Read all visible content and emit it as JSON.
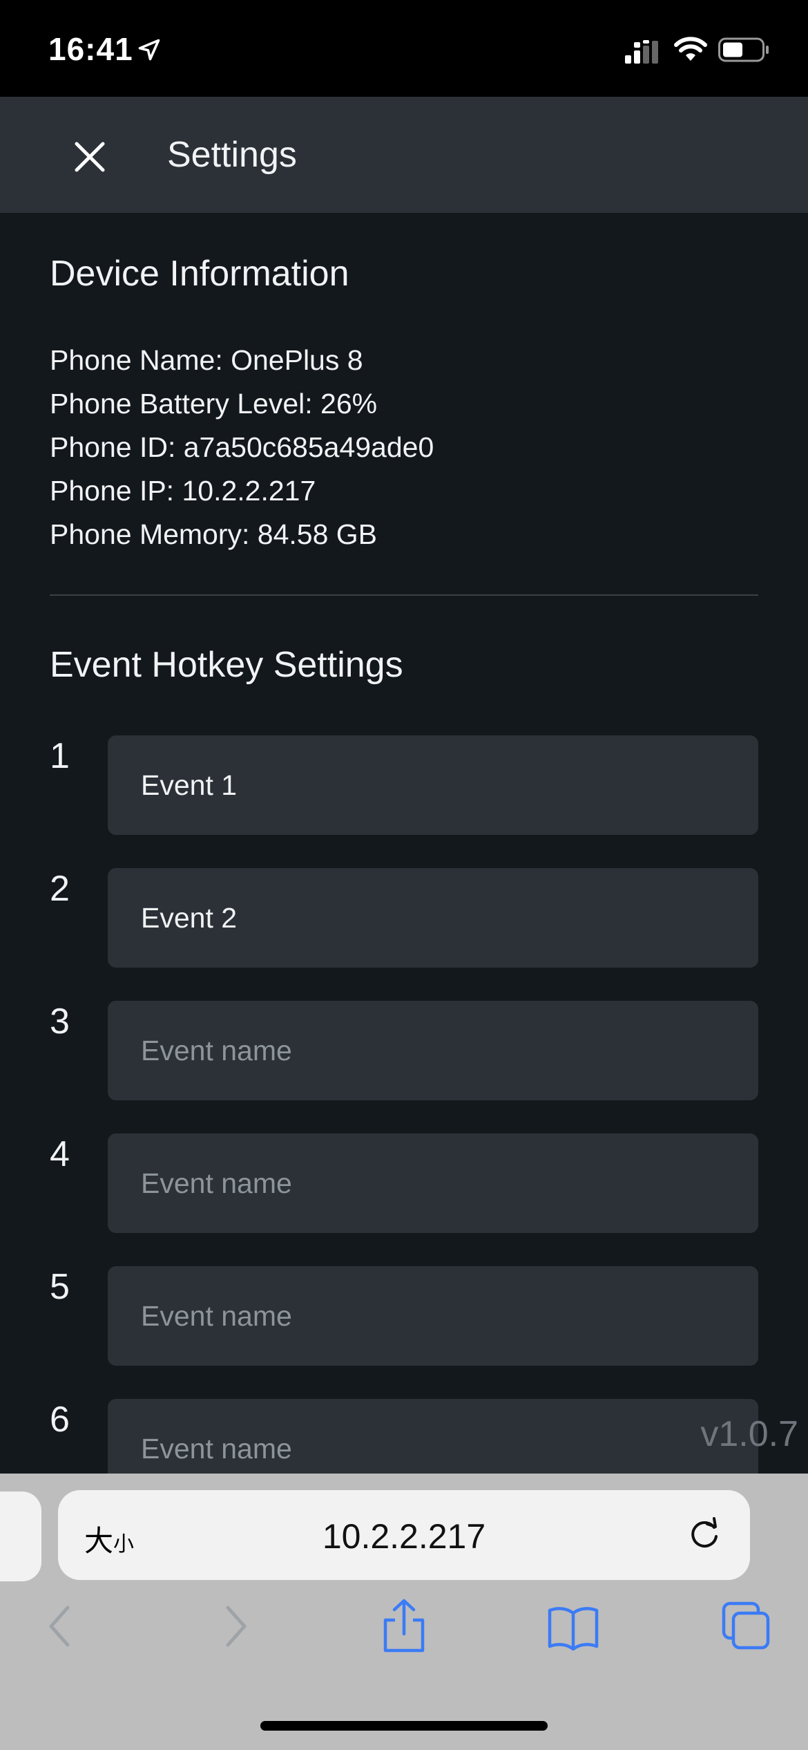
{
  "status_bar": {
    "time": "16:41"
  },
  "header": {
    "title": "Settings"
  },
  "device_info": {
    "title": "Device Information",
    "rows": [
      "Phone Name: OnePlus 8",
      "Phone Battery Level: 26%",
      "Phone ID: a7a50c685a49ade0",
      "Phone IP: 10.2.2.217",
      "Phone Memory: 84.58 GB"
    ]
  },
  "hotkeys": {
    "title": "Event Hotkey Settings",
    "items": [
      {
        "number": "1",
        "value": "Event 1",
        "placeholder": "Event name"
      },
      {
        "number": "2",
        "value": "Event 2",
        "placeholder": "Event name"
      },
      {
        "number": "3",
        "value": "",
        "placeholder": "Event name"
      },
      {
        "number": "4",
        "value": "",
        "placeholder": "Event name"
      },
      {
        "number": "5",
        "value": "",
        "placeholder": "Event name"
      },
      {
        "number": "6",
        "value": "",
        "placeholder": "Event name"
      }
    ]
  },
  "version": "v1.0.7",
  "browser": {
    "text_size_big": "大",
    "text_size_small": "小",
    "url": "10.2.2.217"
  },
  "icons": [
    "location-arrow-icon",
    "cellular-signal-icon",
    "wifi-icon",
    "battery-icon",
    "close-icon",
    "reload-icon",
    "back-icon",
    "forward-icon",
    "share-icon",
    "bookmarks-icon",
    "tabs-icon"
  ],
  "colors": {
    "background": "#13181c",
    "header": "#2b3137",
    "input": "#2b3137",
    "browser_bar": "#bdbdbd",
    "toolbar_active": "#3b7bf6"
  }
}
